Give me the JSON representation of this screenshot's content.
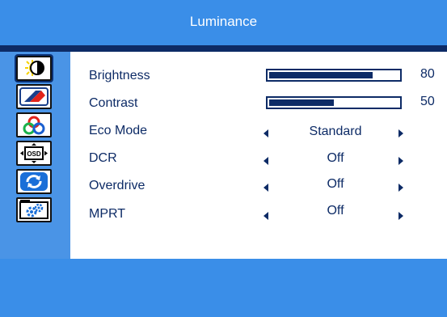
{
  "title": "Luminance",
  "sidebar": {
    "items": [
      {
        "name": "luminance",
        "icon": "brightness-contrast-icon",
        "selected": true
      },
      {
        "name": "image",
        "icon": "image-setup-icon",
        "selected": false
      },
      {
        "name": "color",
        "icon": "color-temp-icon",
        "selected": false
      },
      {
        "name": "osd",
        "icon": "osd-setup-icon",
        "selected": false
      },
      {
        "name": "reset",
        "icon": "reset-icon",
        "selected": false
      },
      {
        "name": "extra",
        "icon": "extra-settings-icon",
        "selected": false
      }
    ]
  },
  "settings": [
    {
      "label": "Brightness",
      "type": "slider",
      "value": "80",
      "percent": 80
    },
    {
      "label": "Contrast",
      "type": "slider",
      "value": "50",
      "percent": 50
    },
    {
      "label": "Eco Mode",
      "type": "select",
      "value": "Standard"
    },
    {
      "label": "DCR",
      "type": "select",
      "value": "Off"
    },
    {
      "label": "Overdrive",
      "type": "select",
      "value": "Off"
    },
    {
      "label": "MPRT",
      "type": "select",
      "value": "Off"
    }
  ],
  "colors": {
    "background": "#3a8ee8",
    "accent_dark": "#0d2b66",
    "panel": "#ffffff"
  }
}
